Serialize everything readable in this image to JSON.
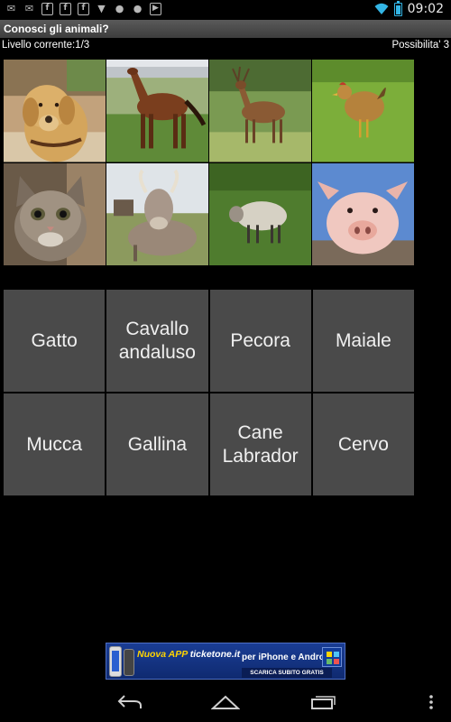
{
  "status_bar": {
    "notification_icons": [
      "gmail-icon",
      "gmail-icon",
      "facebook-icon",
      "facebook-icon",
      "facebook-icon",
      "download-icon",
      "android-icon",
      "android-icon",
      "play-icon"
    ],
    "time": "09:02"
  },
  "app": {
    "title": "Conosci gli animali?",
    "level_text": "Livello corrente:1/3",
    "chances_text": "Possibilita' 3"
  },
  "images": [
    {
      "animal": "dog-labrador",
      "icon": "dog-photo"
    },
    {
      "animal": "horse",
      "icon": "horse-photo"
    },
    {
      "animal": "deer",
      "icon": "deer-photo"
    },
    {
      "animal": "hen",
      "icon": "hen-photo"
    },
    {
      "animal": "cat",
      "icon": "cat-photo"
    },
    {
      "animal": "cow",
      "icon": "cow-photo"
    },
    {
      "animal": "sheep",
      "icon": "sheep-photo"
    },
    {
      "animal": "pig",
      "icon": "pig-photo"
    }
  ],
  "answers": [
    "Gatto",
    "Cavallo\nandaluso",
    "Pecora",
    "Maiale",
    "Mucca",
    "Gallina",
    "Cane\nLabrador",
    "Cervo"
  ],
  "ad": {
    "line1_prefix": "Nuova APP ",
    "brand": "ticketone.it",
    "line2": "per iPhone e Android",
    "cta": "SCARICA SUBITO GRATIS"
  },
  "colors": {
    "button_bg": "#4a4a4a",
    "accent": "#33b5e5"
  }
}
